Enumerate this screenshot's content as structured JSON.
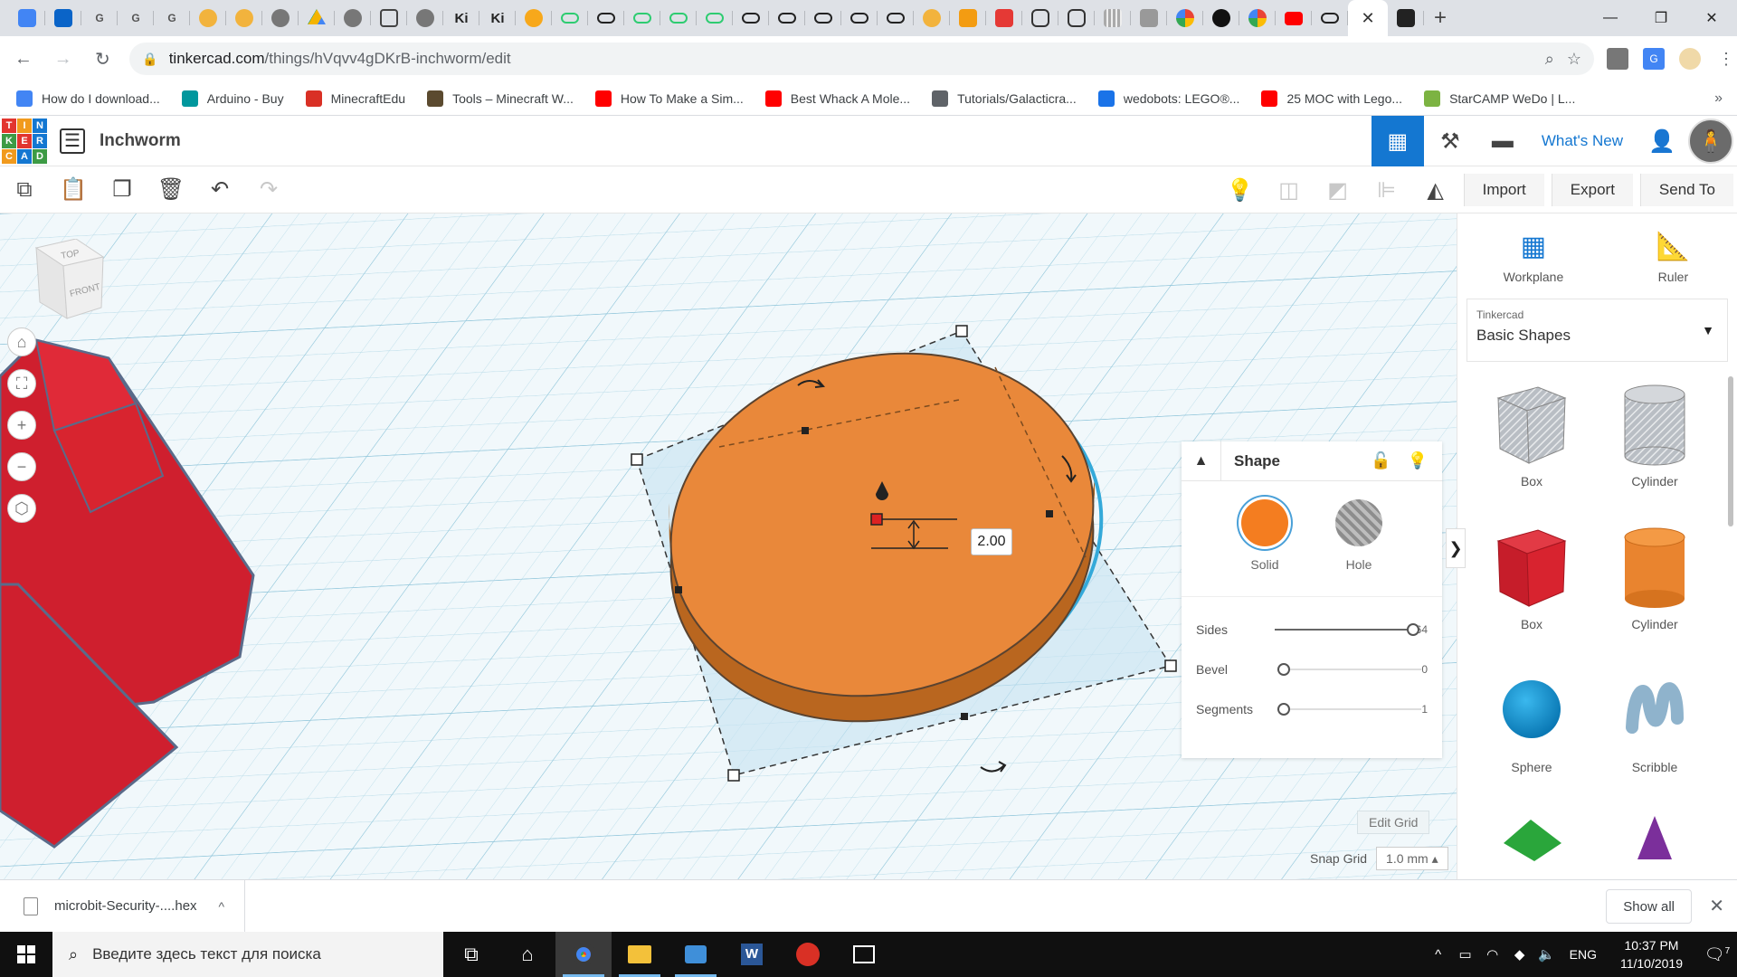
{
  "browser": {
    "url_host": "tinkercad.com",
    "url_path": "/things/hVqvv4gDKrB-inchworm/edit",
    "tab_letters": [
      "G",
      "G",
      "G",
      "Ki",
      "Ki"
    ],
    "bookmarks": [
      {
        "label": "How do I download...",
        "color": "#4285f4"
      },
      {
        "label": "Arduino - Buy",
        "color": "#00979d"
      },
      {
        "label": "MinecraftEdu",
        "color": "#d93025"
      },
      {
        "label": "Tools – Minecraft W...",
        "color": "#5b4a2f"
      },
      {
        "label": "How To Make a Sim...",
        "color": "#ff0000"
      },
      {
        "label": "Best Whack A Mole...",
        "color": "#ff0000"
      },
      {
        "label": "Tutorials/Galacticra...",
        "color": "#5f6368"
      },
      {
        "label": "wedobots: LEGO®...",
        "color": "#1a73e8"
      },
      {
        "label": "25 MOC with Lego...",
        "color": "#ff0000"
      },
      {
        "label": "StarCAMP WeDo | L...",
        "color": "#7cb342"
      }
    ]
  },
  "tinkercad": {
    "logo_letters": [
      "T",
      "I",
      "N",
      "K",
      "E",
      "R",
      "C",
      "A",
      "D"
    ],
    "logo_colors": [
      "#e2352f",
      "#f19a1d",
      "#1477d1",
      "#3d9b45",
      "#e2352f",
      "#1477d1",
      "#f19a1d",
      "#1477d1",
      "#3d9b45"
    ],
    "design_title": "Inchworm",
    "whats_new": "What's New",
    "toolbar": {
      "import_label": "Import",
      "export_label": "Export",
      "send_to_label": "Send To"
    },
    "viewcube": {
      "top_label": "TOP",
      "front_label": "FRONT"
    },
    "dimension_value": "2.00",
    "inspector": {
      "title": "Shape",
      "solid_label": "Solid",
      "hole_label": "Hole",
      "props": [
        {
          "label": "Sides",
          "value": "64",
          "position": 1.0
        },
        {
          "label": "Bevel",
          "value": "0",
          "position": 0.0
        },
        {
          "label": "Segments",
          "value": "1",
          "position": 0.0
        }
      ]
    },
    "grid": {
      "edit_grid_label": "Edit Grid",
      "snap_grid_label": "Snap Grid",
      "snap_grid_value": "1.0 mm"
    },
    "panel": {
      "workplane_label": "Workplane",
      "ruler_label": "Ruler",
      "library_source": "Tinkercad",
      "library_name": "Basic Shapes",
      "shapes": [
        {
          "label": "Box"
        },
        {
          "label": "Cylinder"
        },
        {
          "label": "Box"
        },
        {
          "label": "Cylinder"
        },
        {
          "label": "Sphere"
        },
        {
          "label": "Scribble"
        }
      ]
    },
    "colors": {
      "accent": "#1477d1",
      "solid_orange": "#f47d20",
      "shape_orange": "#e9883a",
      "red_shape": "#cf1f2e"
    }
  },
  "downloads": {
    "file_name": "microbit-Security-....hex",
    "show_all": "Show all"
  },
  "taskbar": {
    "search_placeholder": "Введите здесь текст для поиска",
    "language": "ENG",
    "time": "10:37 PM",
    "date": "11/10/2019",
    "notification_count": "7"
  }
}
